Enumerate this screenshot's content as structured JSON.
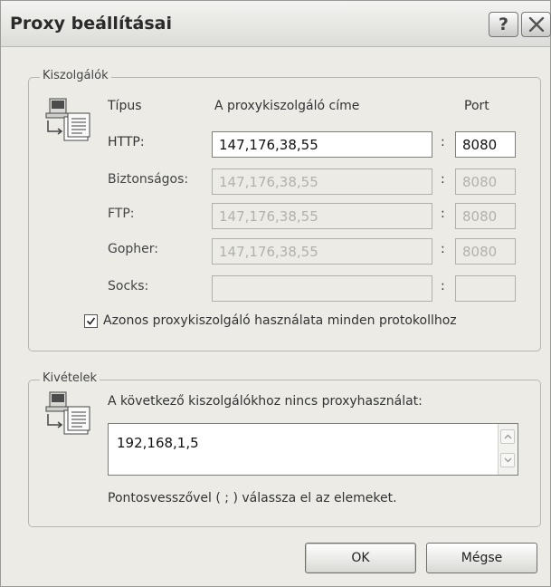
{
  "dialog": {
    "title": "Proxy beállításai",
    "help_label": "?"
  },
  "servers": {
    "legend": "Kiszolgálók",
    "icon": "server-settings-icon",
    "headers": {
      "type": "Típus",
      "address": "A proxykiszolgáló címe",
      "port": "Port"
    },
    "rows": [
      {
        "label": "HTTP:",
        "address": "147,176,38,55",
        "port": "8080",
        "enabled": true
      },
      {
        "label": "Biztonságos:",
        "address": "147,176,38,55",
        "port": "8080",
        "enabled": false
      },
      {
        "label": "FTP:",
        "address": "147,176,38,55",
        "port": "8080",
        "enabled": false
      },
      {
        "label": "Gopher:",
        "address": "147,176,38,55",
        "port": "8080",
        "enabled": false
      },
      {
        "label": "Socks:",
        "address": "",
        "port": "",
        "enabled": false
      }
    ],
    "separator": ":",
    "same_proxy_checkbox": {
      "label": "Azonos proxykiszolgáló használata minden protokollhoz",
      "checked": true
    }
  },
  "exceptions": {
    "legend": "Kivételek",
    "icon": "server-settings-icon",
    "description": "A következő kiszolgálókhoz nincs proxyhasználat:",
    "value": "192,168,1,5",
    "hint": "Pontosvesszővel ( ; ) válassza el az elemeket."
  },
  "buttons": {
    "ok": "OK",
    "cancel": "Mégse"
  }
}
